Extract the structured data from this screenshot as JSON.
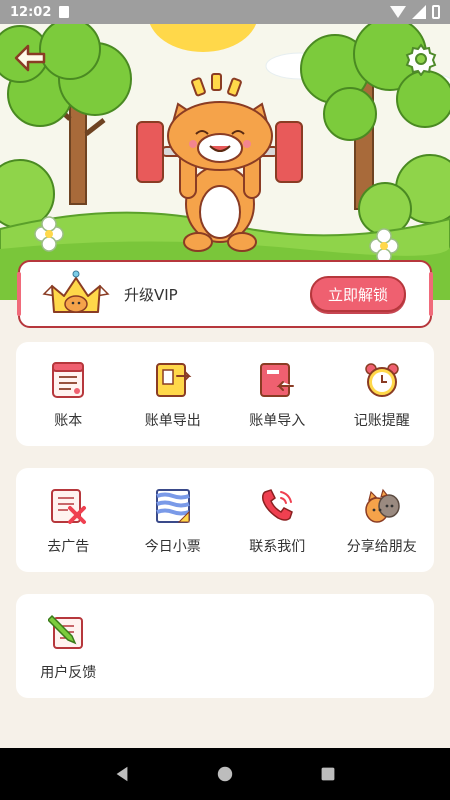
{
  "status_bar": {
    "time": "12:02"
  },
  "header": {
    "back_icon": "back-arrow-icon",
    "settings_icon": "gear-icon"
  },
  "vip": {
    "label": "升级VIP",
    "button_label": "立即解锁",
    "accent": "#ef6070",
    "border": "#b6373c"
  },
  "cards": [
    {
      "items": [
        {
          "label": "账本",
          "icon": "ledger-book-icon"
        },
        {
          "label": "账单导出",
          "icon": "bill-export-icon"
        },
        {
          "label": "账单导入",
          "icon": "bill-import-icon"
        },
        {
          "label": "记账提醒",
          "icon": "alarm-clock-icon"
        }
      ]
    },
    {
      "items": [
        {
          "label": "去广告",
          "icon": "remove-ads-icon"
        },
        {
          "label": "今日小票",
          "icon": "receipt-icon"
        },
        {
          "label": "联系我们",
          "icon": "phone-icon"
        },
        {
          "label": "分享给朋友",
          "icon": "share-cats-icon"
        }
      ]
    },
    {
      "items": [
        {
          "label": "用户反馈",
          "icon": "feedback-pencil-icon"
        }
      ]
    }
  ],
  "nav_bar": {
    "back": "nav-back-icon",
    "home": "nav-home-icon",
    "recents": "nav-recents-icon"
  }
}
